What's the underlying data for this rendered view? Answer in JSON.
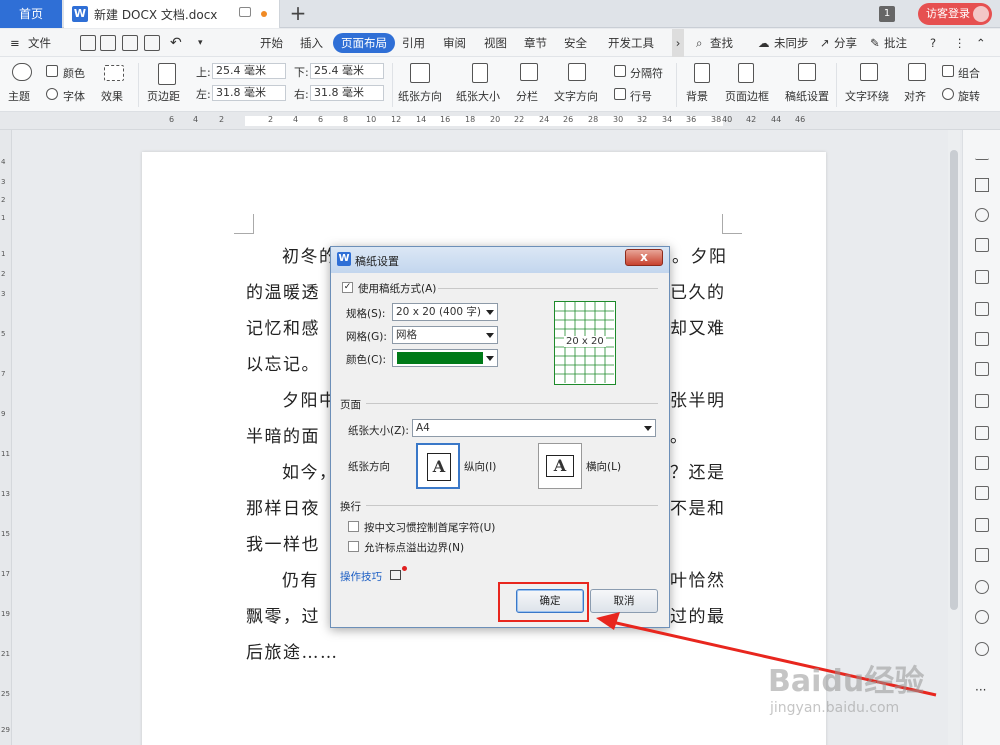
{
  "titlebar": {
    "home_tab": "首页",
    "doc_tab": "新建 DOCX 文档.docx",
    "window_count": "1",
    "login": "访客登录"
  },
  "menubar": {
    "file": "文件",
    "tabs": [
      "开始",
      "插入",
      "页面布局",
      "引用",
      "审阅",
      "视图",
      "章节",
      "安全",
      "开发工具"
    ],
    "active_tab": "页面布局",
    "search": "查找",
    "sync": "未同步",
    "share": "分享",
    "annotate": "批注"
  },
  "ribbon": {
    "theme": "主题",
    "colors": "颜色",
    "fonts": "字体",
    "effects": "效果",
    "margins": "页边距",
    "top_label": "上:",
    "top_value": "25.4 毫米",
    "bottom_label": "下:",
    "bottom_value": "25.4 毫米",
    "left_label": "左:",
    "left_value": "31.8 毫米",
    "right_label": "右:",
    "right_value": "31.8 毫米",
    "orientation": "纸张方向",
    "size": "纸张大小",
    "columns": "分栏",
    "text_direction": "文字方向",
    "separator": "分隔符",
    "line_number": "行号",
    "background": "背景",
    "page_border": "页面边框",
    "manuscript": "稿纸设置",
    "wrap": "文字环绕",
    "align": "对齐",
    "group": "组合",
    "rotate": "旋转"
  },
  "ruler": {
    "left_marks": [
      "6",
      "4",
      "2"
    ],
    "marks": [
      "2",
      "4",
      "6",
      "8",
      "10",
      "12",
      "14",
      "16",
      "18",
      "20",
      "22",
      "24",
      "26",
      "28",
      "30",
      "32",
      "34",
      "36",
      "38"
    ],
    "right_marks": [
      "40",
      "42",
      "44",
      "46"
    ]
  },
  "document": {
    "lines": [
      "初冬的……夕阳",
      "的温暖透过……已久的",
      "记忆和感……却又难",
      "以忘记。",
      "夕阳中……张半明",
      "半暗的面……。",
      "如今，……？还是",
      "那样日夜……不是和",
      "我一样也……",
      "仍有……叶恰然",
      "飘零，过……过的最",
      "后旅途……"
    ],
    "row_left": [
      "初冬的",
      "的温暖透",
      "记忆和感",
      "以忘记。",
      "夕阳中",
      "半暗的面",
      "如今，",
      "那样日夜",
      "我一样也",
      "仍有",
      "飘零，过",
      "后旅途……"
    ],
    "row_right": [
      "。夕阳",
      "已久的",
      "却又难",
      "",
      "张半明",
      "。",
      "？还是",
      "不是和",
      "",
      "叶恰然",
      "过的最",
      ""
    ]
  },
  "dialog": {
    "title": "稿纸设置",
    "close": "x",
    "use_manuscript": "使用稿纸方式(A)",
    "spec_label": "规格(S):",
    "spec_value": "20 x 20 (400 字)",
    "grid_label": "网格(G):",
    "grid_value": "网格",
    "color_label": "颜色(C):",
    "color_value": "#007a18",
    "preview_label": "20 x 20",
    "page_section": "页面",
    "paper_size_label": "纸张大小(Z):",
    "paper_size_value": "A4",
    "orientation_label": "纸张方向",
    "portrait": "纵向(I)",
    "landscape": "横向(L)",
    "wrap_section": "换行",
    "opt_chinese": "按中文习惯控制首尾字符(U)",
    "opt_punct": "允许标点溢出边界(N)",
    "tips": "操作技巧",
    "ok": "确定",
    "cancel": "取消"
  },
  "watermark": {
    "brand": "Baidu经验",
    "url": "jingyan.baidu.com"
  },
  "colors": {
    "accent": "#2f6fd6",
    "highlight": "#e8261e",
    "grid_green": "#1d8a2a"
  }
}
